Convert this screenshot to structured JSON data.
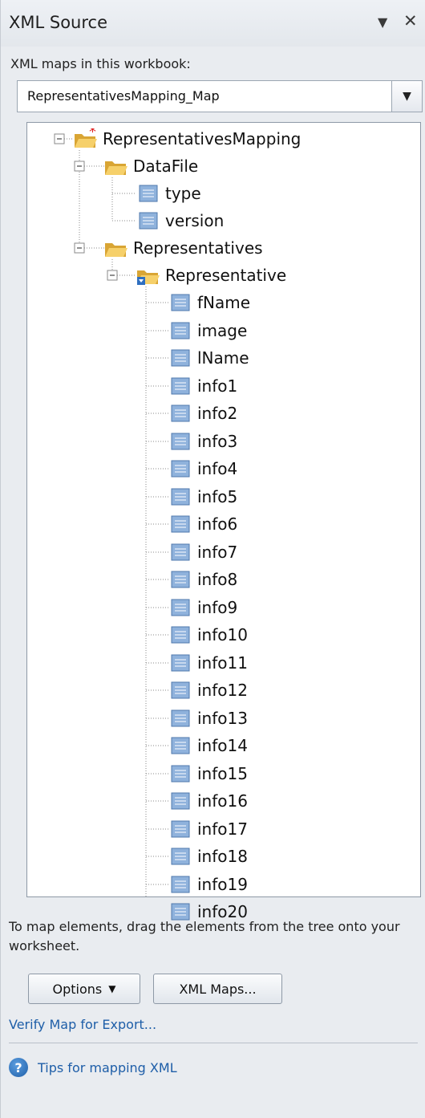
{
  "pane": {
    "title": "XML Source",
    "dropdown_icon": "triangle-down-icon",
    "close_icon": "close-icon"
  },
  "maps_label": "XML maps in this workbook:",
  "map_select": {
    "value": "RepresentativesMapping_Map"
  },
  "tree": {
    "root": "RepresentativesMapping",
    "datafile": "DataFile",
    "type": "type",
    "version": "version",
    "representatives": "Representatives",
    "representative": "Representative",
    "fields": [
      "fName",
      "image",
      "lName",
      "info1",
      "info2",
      "info3",
      "info4",
      "info5",
      "info6",
      "info7",
      "info8",
      "info9",
      "info10",
      "info11",
      "info12",
      "info13",
      "info14",
      "info15",
      "info16",
      "info17",
      "info18",
      "info19",
      "info20"
    ]
  },
  "hint": "To map elements, drag the elements from the tree onto your worksheet.",
  "buttons": {
    "options": "Options",
    "xml_maps": "XML Maps..."
  },
  "links": {
    "verify": "Verify Map for Export...",
    "tips": "Tips for mapping XML"
  },
  "colors": {
    "folder": "#f1c24b",
    "element": "#8fb2dc",
    "link": "#1e5ea8",
    "root_marker": "#e02020"
  }
}
